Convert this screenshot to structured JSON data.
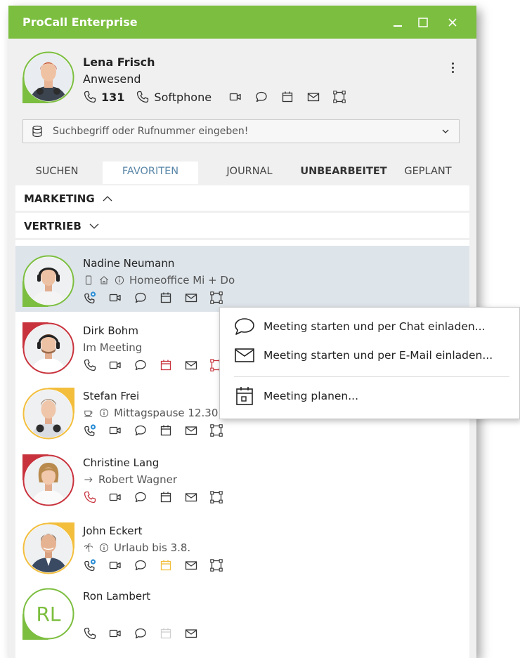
{
  "window": {
    "title": "ProCall Enterprise"
  },
  "colors": {
    "brand": "#7cbe3f",
    "present": "#7cbe3f",
    "busy": "#c8323c",
    "away": "#f2be3c",
    "tab_active": "#5a87a8"
  },
  "me": {
    "name": "Lena Frisch",
    "status": "Anwesend",
    "number": "131",
    "device": "Softphone"
  },
  "search": {
    "placeholder": "Suchbegriff oder Rufnummer eingeben!"
  },
  "tabs": [
    {
      "label": "SUCHEN"
    },
    {
      "label": "FAVORITEN"
    },
    {
      "label": "JOURNAL"
    },
    {
      "label": "UNBEARBEITET"
    },
    {
      "label": "GEPLANT"
    }
  ],
  "groups": [
    {
      "label": "MARKETING",
      "icon": "chevron-up-icon"
    },
    {
      "label": "VERTRIEB",
      "icon": "chevron-down-icon"
    }
  ],
  "contacts": [
    {
      "name": "Nadine Neumann",
      "status": "Homeoffice Mi + Do",
      "presence": "present"
    },
    {
      "name": "Dirk Bohm",
      "status": "Im Meeting",
      "presence": "busy"
    },
    {
      "name": "Stefan Frei",
      "status": "Mittagspause 12.30",
      "presence": "away"
    },
    {
      "name": "Christine Lang",
      "status": "Robert Wagner",
      "presence": "busy"
    },
    {
      "name": "John Eckert",
      "status": "Urlaub bis 3.8.",
      "presence": "away"
    },
    {
      "name": "Ron Lambert",
      "status": "",
      "initials": "RL",
      "presence": "present"
    }
  ],
  "context_menu": {
    "items": [
      {
        "label": "Meeting starten und per Chat einladen...",
        "icon": "chat-bubble-icon"
      },
      {
        "label": "Meeting starten und per E-Mail einladen...",
        "icon": "envelope-icon"
      },
      {
        "label": "Meeting planen...",
        "icon": "calendar-icon"
      }
    ]
  }
}
